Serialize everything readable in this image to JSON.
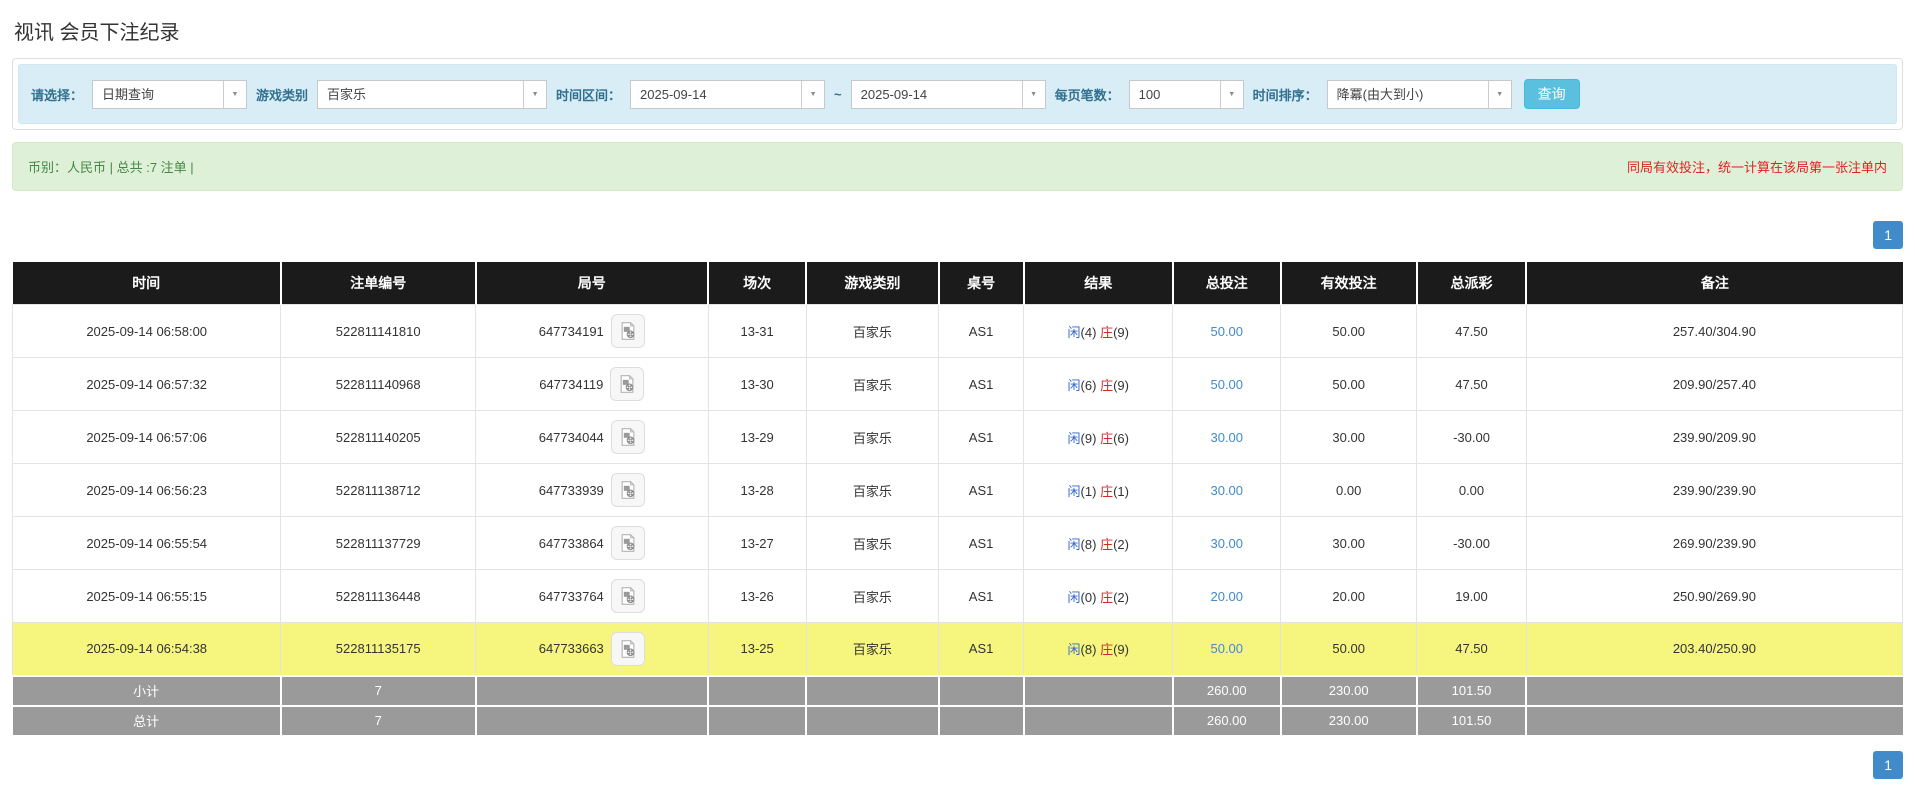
{
  "page": {
    "title": "视讯 会员下注纪录"
  },
  "colors": {
    "player_blue": "#3366cc",
    "banker_red": "#d02a2a",
    "link_blue": "#428bca",
    "negative_red": "#e02222",
    "highlight_yellow": "#f6f67e"
  },
  "filters": {
    "select_label": "请选择：",
    "select_value": "日期查询",
    "game_label": "游戏类别",
    "game_value": "百家乐",
    "range_label": "时间区间：",
    "date_from": "2025-09-14",
    "tilde": "~",
    "date_to": "2025-09-14",
    "page_size_label": "每页笔数：",
    "page_size_value": "100",
    "sort_label": "时间排序：",
    "sort_value": "降冪(由大到小)",
    "search_button": "查询"
  },
  "summary": {
    "left": "币别：人民币 | 总共 :7 注单 |",
    "right": "同局有效投注，统一计算在该局第一张注单内"
  },
  "pagination": {
    "page": "1"
  },
  "table": {
    "headers": [
      "时间",
      "注单编号",
      "局号",
      "场次",
      "游戏类别",
      "桌号",
      "结果",
      "总投注",
      "有效投注",
      "总派彩",
      "备注"
    ],
    "rows": [
      {
        "time": "2025-09-14 06:58:00",
        "bet_id": "522811141810",
        "round_id": "647734191",
        "session": "13-31",
        "game": "百家乐",
        "table_no": "AS1",
        "result": {
          "player_label": "闲",
          "player_value": "(4)",
          "banker_label": "庄",
          "banker_value": "(9)"
        },
        "total_bet": "50.00",
        "valid_bet": "50.00",
        "payout": "47.50",
        "remark": "257.40/304.90",
        "highlight": false
      },
      {
        "time": "2025-09-14 06:57:32",
        "bet_id": "522811140968",
        "round_id": "647734119",
        "session": "13-30",
        "game": "百家乐",
        "table_no": "AS1",
        "result": {
          "player_label": "闲",
          "player_value": "(6)",
          "banker_label": "庄",
          "banker_value": "(9)"
        },
        "total_bet": "50.00",
        "valid_bet": "50.00",
        "payout": "47.50",
        "remark": "209.90/257.40",
        "highlight": false
      },
      {
        "time": "2025-09-14 06:57:06",
        "bet_id": "522811140205",
        "round_id": "647734044",
        "session": "13-29",
        "game": "百家乐",
        "table_no": "AS1",
        "result": {
          "player_label": "闲",
          "player_value": "(9)",
          "banker_label": "庄",
          "banker_value": "(6)"
        },
        "total_bet": "30.00",
        "valid_bet": "30.00",
        "payout": "-30.00",
        "remark": "239.90/209.90",
        "highlight": false
      },
      {
        "time": "2025-09-14 06:56:23",
        "bet_id": "522811138712",
        "round_id": "647733939",
        "session": "13-28",
        "game": "百家乐",
        "table_no": "AS1",
        "result": {
          "player_label": "闲",
          "player_value": "(1)",
          "banker_label": "庄",
          "banker_value": "(1)"
        },
        "total_bet": "30.00",
        "valid_bet": "0.00",
        "payout": "0.00",
        "remark": "239.90/239.90",
        "highlight": false
      },
      {
        "time": "2025-09-14 06:55:54",
        "bet_id": "522811137729",
        "round_id": "647733864",
        "session": "13-27",
        "game": "百家乐",
        "table_no": "AS1",
        "result": {
          "player_label": "闲",
          "player_value": "(8)",
          "banker_label": "庄",
          "banker_value": "(2)"
        },
        "total_bet": "30.00",
        "valid_bet": "30.00",
        "payout": "-30.00",
        "remark": "269.90/239.90",
        "highlight": false
      },
      {
        "time": "2025-09-14 06:55:15",
        "bet_id": "522811136448",
        "round_id": "647733764",
        "session": "13-26",
        "game": "百家乐",
        "table_no": "AS1",
        "result": {
          "player_label": "闲",
          "player_value": "(0)",
          "banker_label": "庄",
          "banker_value": "(2)"
        },
        "total_bet": "20.00",
        "valid_bet": "20.00",
        "payout": "19.00",
        "remark": "250.90/269.90",
        "highlight": false
      },
      {
        "time": "2025-09-14 06:54:38",
        "bet_id": "522811135175",
        "round_id": "647733663",
        "session": "13-25",
        "game": "百家乐",
        "table_no": "AS1",
        "result": {
          "player_label": "闲",
          "player_value": "(8)",
          "banker_label": "庄",
          "banker_value": "(9)"
        },
        "total_bet": "50.00",
        "valid_bet": "50.00",
        "payout": "47.50",
        "remark": "203.40/250.90",
        "highlight": true
      }
    ],
    "subtotal": {
      "label": "小计",
      "count": "7",
      "total_bet": "260.00",
      "valid_bet": "230.00",
      "payout": "101.50"
    },
    "total": {
      "label": "总计",
      "count": "7",
      "total_bet": "260.00",
      "valid_bet": "230.00",
      "payout": "101.50"
    }
  }
}
